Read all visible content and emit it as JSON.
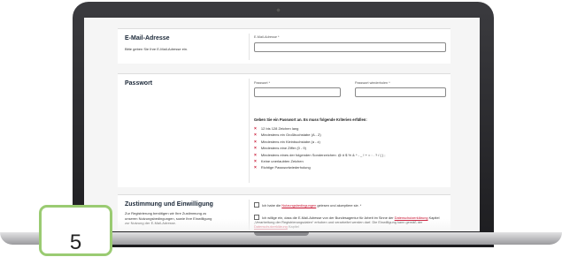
{
  "email_section": {
    "title": "E-Mail-Adresse",
    "description": "Bitte geben Sie Ihre E-Mail-Adresse ein.",
    "field_label": "E-Mail-Adresse *",
    "value": ""
  },
  "password_section": {
    "title": "Passwort",
    "password_label": "Passwort *",
    "password_repeat_label": "Passwort wiederholen *",
    "criteria_heading": "Geben Sie ein Passwort an. Es muss folgende Kriterien erfüllen:",
    "criteria_mark": "×",
    "criteria": [
      "12 bis 128 Zeichen lang",
      "Mindestens ein Großbuchstabe (A - Z)",
      "Mindestens ein Kleinbuchstabe (a - z)",
      "Mindestens eine Ziffer (0 - 9)",
      "Mindestens eines der folgenden Sonderzeichen: @ # $ % & * - _ ! + = : . ? / ( ) ;",
      "Keine unerlaubten Zeichen",
      "Richtige Passwortwiederholung"
    ]
  },
  "consent_section": {
    "title": "Zustimmung und Einwilligung",
    "description": "Zur Registrierung benötigen wir Ihre Zustimmung zu unseren Nutzungsbedingungen, sowie Ihre Einwilligung zur Nutzung der E-Mail-Adresse.",
    "terms_prefix": "Ich habe die",
    "terms_link": "Nutzungsbedingungen",
    "terms_suffix": "gelesen und akzeptiere sie. *",
    "consent_prefix": "Ich willige ein, dass die E-Mail-Adresse von der Bundesagentur für Arbeit im Sinne der",
    "consent_link1": "Datenschutzerklärung",
    "consent_middle": "Kapitel „Verarbeitung der Registrierungsdaten“ erhoben und verarbeitet werden darf. Die Einwilligung kann gemäß der",
    "consent_link2": "Datenschutzerklärung",
    "consent_suffix": "Kapitel"
  },
  "step_badge": {
    "number": "5"
  },
  "colors": {
    "accent": "#c8102e",
    "badge_border": "#9acb72"
  }
}
